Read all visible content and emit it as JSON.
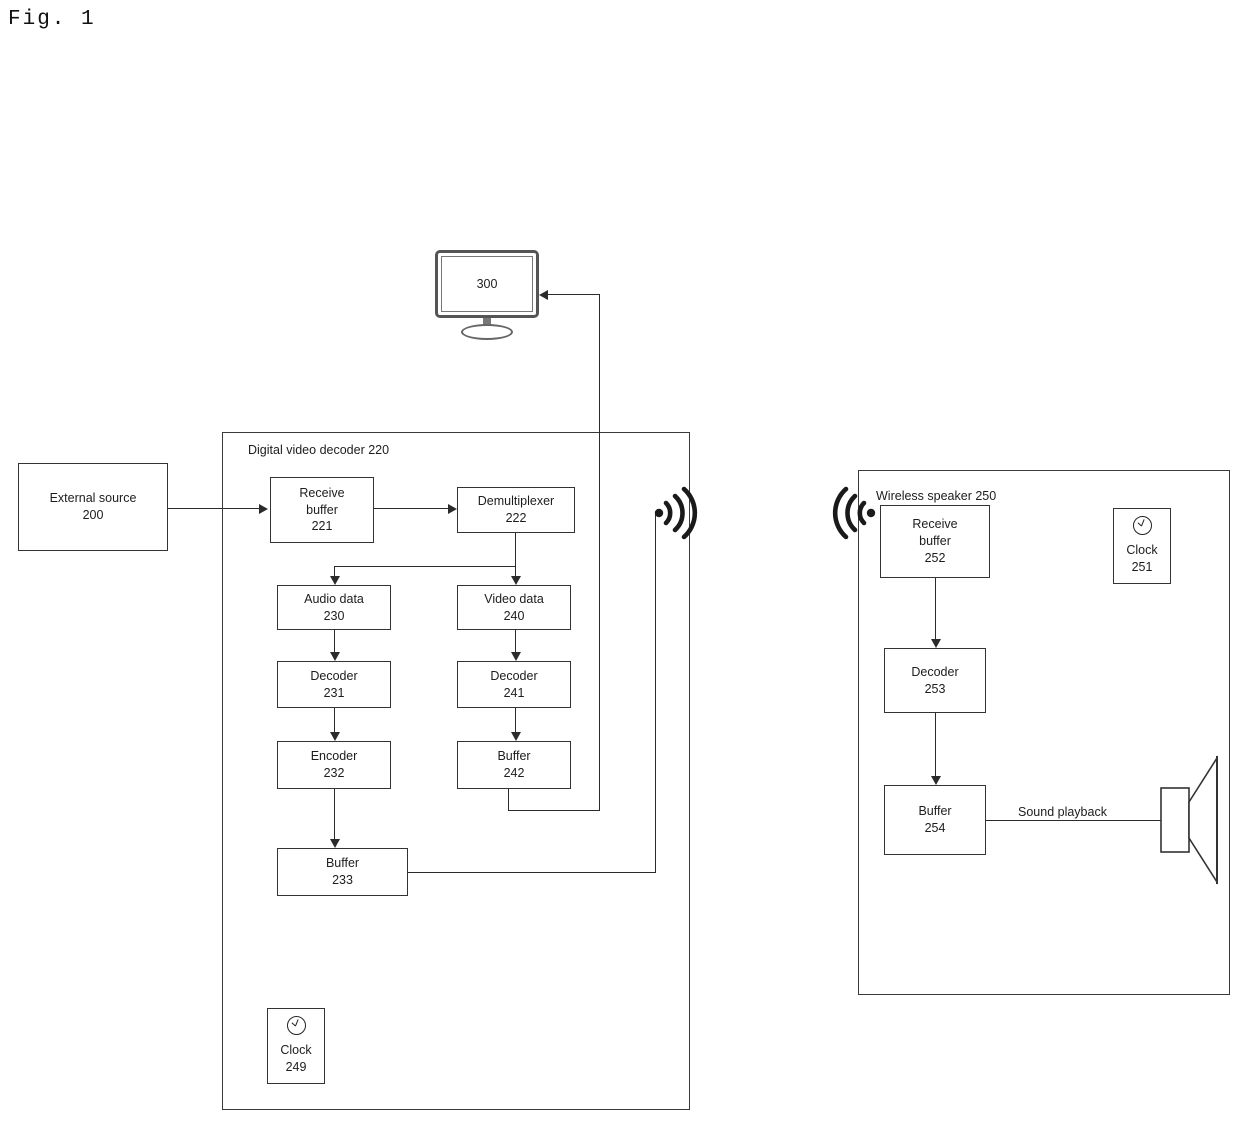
{
  "figure": {
    "title": "Fig. 1"
  },
  "display": {
    "name": "display-monitor",
    "label": "300"
  },
  "external_source": {
    "line1": "External source",
    "line2": "200"
  },
  "decoder": {
    "container_label": "Digital video decoder 220",
    "nodes": {
      "receive_buffer": {
        "line1": "Receive",
        "line2": "buffer",
        "line3": "221"
      },
      "demultiplexer": {
        "line1": "Demultiplexer",
        "line2": "222"
      },
      "audio_data": {
        "line1": "Audio data",
        "line2": "230"
      },
      "video_data": {
        "line1": "Video data",
        "line2": "240"
      },
      "audio_decoder": {
        "line1": "Decoder",
        "line2": "231"
      },
      "video_decoder": {
        "line1": "Decoder",
        "line2": "241"
      },
      "audio_encoder": {
        "line1": "Encoder",
        "line2": "232"
      },
      "video_buffer": {
        "line1": "Buffer",
        "line2": "242"
      },
      "audio_buffer": {
        "line1": "Buffer",
        "line2": "233"
      },
      "clock": {
        "line1": "Clock",
        "line2": "249",
        "icon": "clock-icon"
      }
    }
  },
  "speaker": {
    "container_label": "Wireless speaker 250",
    "nodes": {
      "receive_buffer": {
        "line1": "Receive",
        "line2": "buffer",
        "line3": "252"
      },
      "decoder": {
        "line1": "Decoder",
        "line2": "253"
      },
      "buffer": {
        "line1": "Buffer",
        "line2": "254"
      },
      "clock": {
        "line1": "Clock",
        "line2": "251",
        "icon": "clock-icon"
      }
    },
    "sound_playback_label": "Sound playback",
    "speaker_icon": "loudspeaker-icon"
  },
  "wireless": {
    "transmit_icon": "wireless-transmit-icon",
    "receive_icon": "wireless-receive-icon"
  },
  "colors": {
    "stroke": "#2b2b2b",
    "text": "#1d1d1d",
    "background": "#ffffff"
  }
}
